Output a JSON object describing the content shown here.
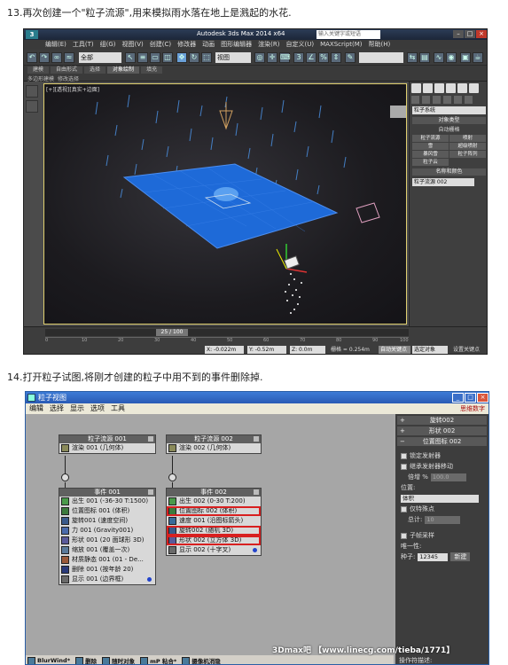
{
  "captions": {
    "step13": "13.再次创建一个\"粒子流源\",用来模拟雨水落在地上是溅起的水花.",
    "step14": "14.打开粒子试图,将刚才创建的粒子中用不到的事件删除掉."
  },
  "max_window": {
    "title": "Autodesk 3ds Max  2014 x64",
    "search_placeholder": "输入关键字或短语",
    "menu": [
      "编辑(E)",
      "工具(T)",
      "组(G)",
      "视图(V)",
      "创建(C)",
      "修改器",
      "动画",
      "图形编辑器",
      "渲染(R)",
      "自定义(U)",
      "MAXScript(M)",
      "帮助(H)"
    ],
    "selection_filter": "全部",
    "view_dropdown": "视图",
    "ribbon_tabs": [
      "建模",
      "自由形式",
      "选择",
      "对象绘制",
      "填充"
    ],
    "ribbon_sub": [
      "多边形建模",
      "修改选择"
    ],
    "viewport_label": "[+][透视][真实+边面]",
    "timeline_counter": "25 / 100",
    "ruler_ticks": [
      "0",
      "10",
      "20",
      "30",
      "40",
      "50",
      "60",
      "70",
      "80",
      "90",
      "100"
    ],
    "coords": {
      "x": "X: -0.022m",
      "y": "Y: -0.52m",
      "z": "Z: 0.0m",
      "grid": "栅格 = 0.254m"
    },
    "status": {
      "autokey": "自动关键点",
      "selected_obj": "选定对象",
      "setkey": "设置关键点"
    },
    "command_panel": {
      "category": "粒子系统",
      "object_type_header": "对象类型",
      "autogrid": "自动栅格",
      "types": [
        "粒子流源",
        "喷射",
        "雪",
        "超级喷射",
        "暴风雪",
        "粒子阵列",
        "粒子云"
      ],
      "name_color_header": "名称和颜色",
      "name_value": "粒子流源 002"
    },
    "accent_color": "#1e6ad8"
  },
  "particle_view": {
    "title": "粒子视图",
    "menu": [
      "编辑",
      "选择",
      "显示",
      "选项",
      "工具"
    ],
    "brand": "思维数字",
    "flow1": {
      "header": "粒子流源 001",
      "render": "渲染 001 (几何体)"
    },
    "flow2": {
      "header": "粒子流源 002",
      "render": "渲染 002 (几何体)"
    },
    "event1": {
      "header": "事件 001",
      "ops": [
        "出生 001 (-36-30 T:1500)",
        "位置图标 001 (体积)",
        "旋转001 (速度空间)",
        "力 001 (Gravity001)",
        "形状 001 (20 面球形 3D)",
        "缩放 001 (覆盖一次)",
        "材质静态 001 (01 - De...",
        "删除 001 (按年龄 20)",
        "显示 001 (边界框)"
      ]
    },
    "event2": {
      "header": "事件 002",
      "ops": [
        "出生 002 (0-30 T:200)",
        "位置图标 002 (体积)",
        "速度 001 (沿图标箭头)",
        "旋转002 (随机 3D)",
        "形状 002 (立方体 3D)",
        "显示 002 (十字叉)"
      ],
      "highlighted_indices": [
        1,
        3,
        4
      ]
    },
    "rollouts": [
      "旋转002",
      "形状 002",
      "位置图标 002"
    ],
    "props": {
      "lock_emitter": "锁定发射器",
      "inherit_motion": "继承发射器移动",
      "multiplier_label": "倍增 %",
      "multiplier_value": "100.0",
      "location_label": "位置:",
      "location_value": "体积",
      "distinct_points": "仅特殊点",
      "total_label": "总计:",
      "total_value": "10",
      "sub_frame": "子帧采样",
      "uniqueness_label": "唯一性:",
      "seed_label": "种子:",
      "seed_value": "12345",
      "new_button": "新建"
    },
    "depot": [
      "BlurWind*",
      "删除",
      "随时对象",
      "mP 粘合*",
      "摄像机消隐",
      "播放速度",
      "操作符描述:"
    ],
    "watermark": "3Dmax吧 【www.linecg.com/tieba/1771】",
    "highlight_color": "#d82020"
  }
}
